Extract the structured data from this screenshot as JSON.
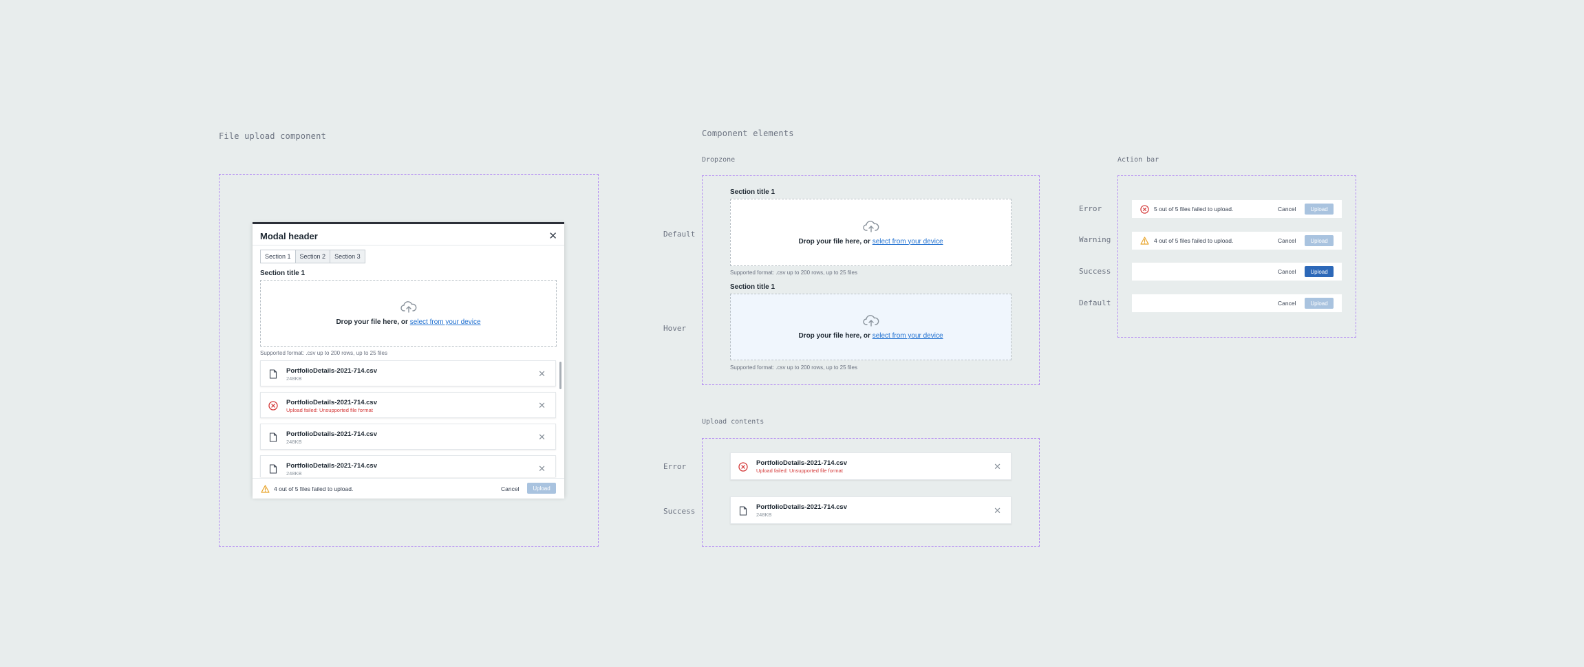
{
  "labels": {
    "file_upload_component": "File upload component",
    "component_elements": "Component elements",
    "dropzone": "Dropzone",
    "action_bar": "Action bar",
    "upload_contents": "Upload contents",
    "default": "Default",
    "hover": "Hover",
    "error": "Error",
    "warning": "Warning",
    "success": "Success"
  },
  "modal": {
    "header": "Modal header",
    "close_icon": "close-icon",
    "tabs": [
      {
        "label": "Section 1",
        "active": true
      },
      {
        "label": "Section 2",
        "active": false
      },
      {
        "label": "Section 3",
        "active": false
      }
    ],
    "section_title": "Section title 1",
    "files": [
      {
        "name": "PortfolioDetails-2021-714.csv",
        "meta": "248KB",
        "status": "ok"
      },
      {
        "name": "PortfolioDetails-2021-714.csv",
        "meta": "Upload failed: Unsupported file format",
        "status": "error"
      },
      {
        "name": "PortfolioDetails-2021-714.csv",
        "meta": "248KB",
        "status": "ok"
      },
      {
        "name": "PortfolioDetails-2021-714.csv",
        "meta": "248KB",
        "status": "ok"
      }
    ],
    "action_message": "4 out of 5 files failed to upload."
  },
  "dropzone": {
    "text_prefix": "Drop your file here, or ",
    "link": "select from your device",
    "hint": "Supported format: .csv up to 200 rows, up to 25 files",
    "section_title": "Section title 1"
  },
  "actionbar": {
    "cancel": "Cancel",
    "upload": "Upload",
    "error_message": "5 out of 5 files failed to upload.",
    "warning_message": "4 out of 5 files failed to upload."
  },
  "upload_contents": {
    "error_file": {
      "name": "PortfolioDetails-2021-714.csv",
      "meta": "Upload failed: Unsupported file format"
    },
    "success_file": {
      "name": "PortfolioDetails-2021-714.csv",
      "meta": "248KB"
    }
  },
  "colors": {
    "background": "#e8eded",
    "dashed_outline": "#b38bf2",
    "link": "#1e6fd0",
    "error": "#d43a3a",
    "warning": "#e8a42a",
    "primary": "#2c68b8",
    "disabled": "#a9c3df"
  }
}
